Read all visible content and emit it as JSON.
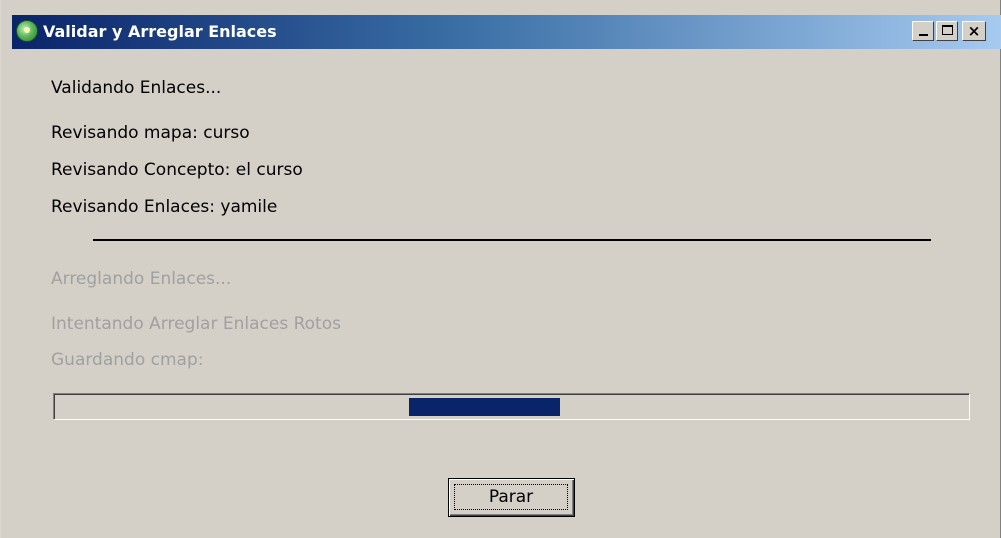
{
  "window": {
    "title": "Validar y Arreglar Enlaces",
    "controls": {
      "minimize": "_",
      "maximize": "□",
      "close": "×"
    }
  },
  "validation": {
    "heading": "Validando Enlaces...",
    "map_line": "Revisando mapa: curso",
    "concept_line": "Revisando Concepto: el curso",
    "links_line": "Revisando Enlaces: yamile"
  },
  "repair": {
    "heading": "Arreglando Enlaces...",
    "attempt_line": "Intentando Arreglar Enlaces Rotos",
    "saving_line": "Guardando cmap:"
  },
  "progress": {
    "indeterminate": true,
    "block_start_fraction": 0.388,
    "block_end_fraction": 0.553
  },
  "actions": {
    "stop_label": "Parar"
  },
  "colors": {
    "title_gradient_start": "#0a246a",
    "title_gradient_end": "#a6caf0",
    "progress_fill": "#0a246a",
    "disabled_text": "#a0a0a0",
    "window_face": "#d4d0c8"
  }
}
